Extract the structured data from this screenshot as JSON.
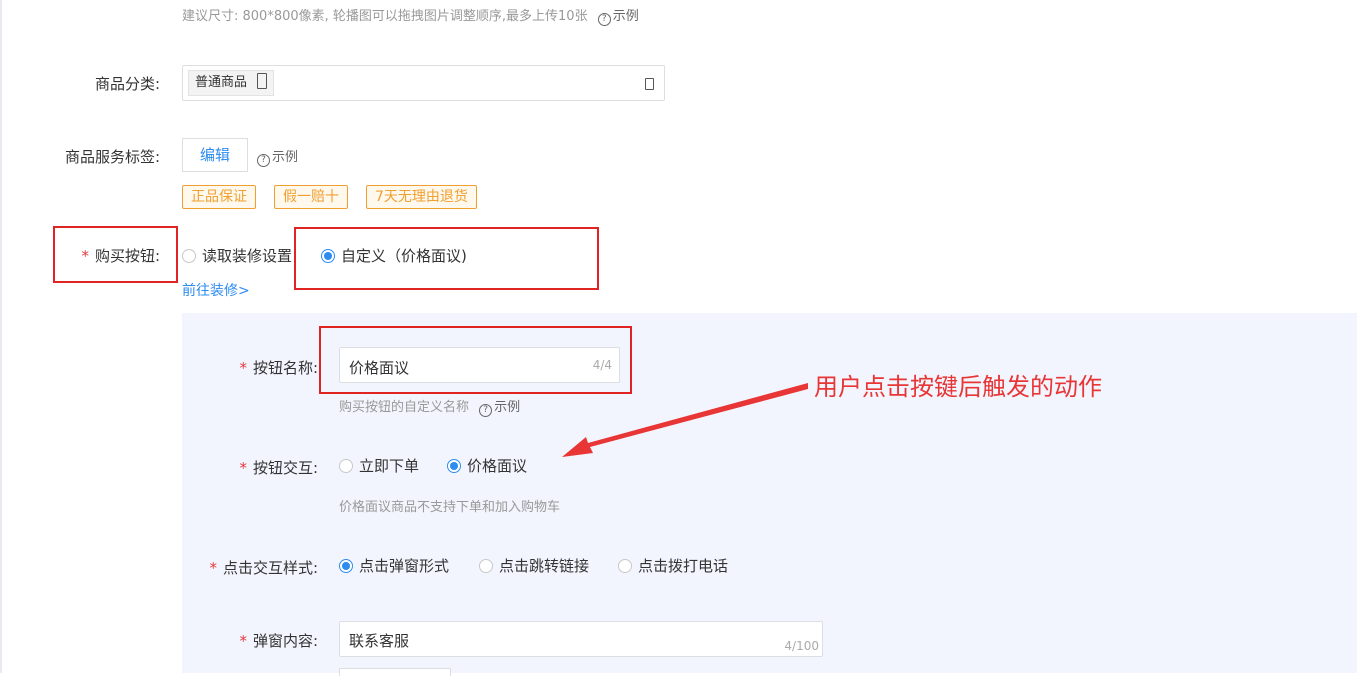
{
  "top_hint": "建议尺寸: 800*800像素, 轮播图可以拖拽图片调整顺序,最多上传10张",
  "top_hint_example": "示例",
  "category": {
    "label": "商品分类:",
    "selected_tag": "普通商品"
  },
  "service_tags": {
    "label": "商品服务标签:",
    "edit_button": "编辑",
    "example": "示例",
    "tags": [
      "正品保证",
      "假一赔十",
      "7天无理由退货"
    ]
  },
  "buy_button": {
    "required_mark": "*",
    "label": "购买按钮:",
    "options": [
      "读取装修设置",
      "自定义（价格面议)"
    ],
    "selected_index": 1,
    "decorate_link": "前往装修>"
  },
  "button_name": {
    "label": "按钮名称:",
    "value": "价格面议",
    "counter": "4/4",
    "hint": "购买按钮的自定义名称",
    "example": "示例"
  },
  "button_interaction": {
    "label": "按钮交互:",
    "options": [
      "立即下单",
      "价格面议"
    ],
    "selected_index": 1,
    "hint": "价格面议商品不支持下单和加入购物车"
  },
  "click_style": {
    "label": "点击交互样式:",
    "options": [
      "点击弹窗形式",
      "点击跳转链接",
      "点击拨打电话"
    ],
    "selected_index": 0
  },
  "popup_content": {
    "label": "弹窗内容:",
    "value": "联系客服",
    "counter": "4/100"
  },
  "annotation": {
    "text": "用户点击按键后触发的动作"
  },
  "colors": {
    "accent": "#2d8cf0",
    "tag": "#f0a030",
    "annotation_red": "#e02424",
    "panel_bg": "#f2f5fd"
  }
}
